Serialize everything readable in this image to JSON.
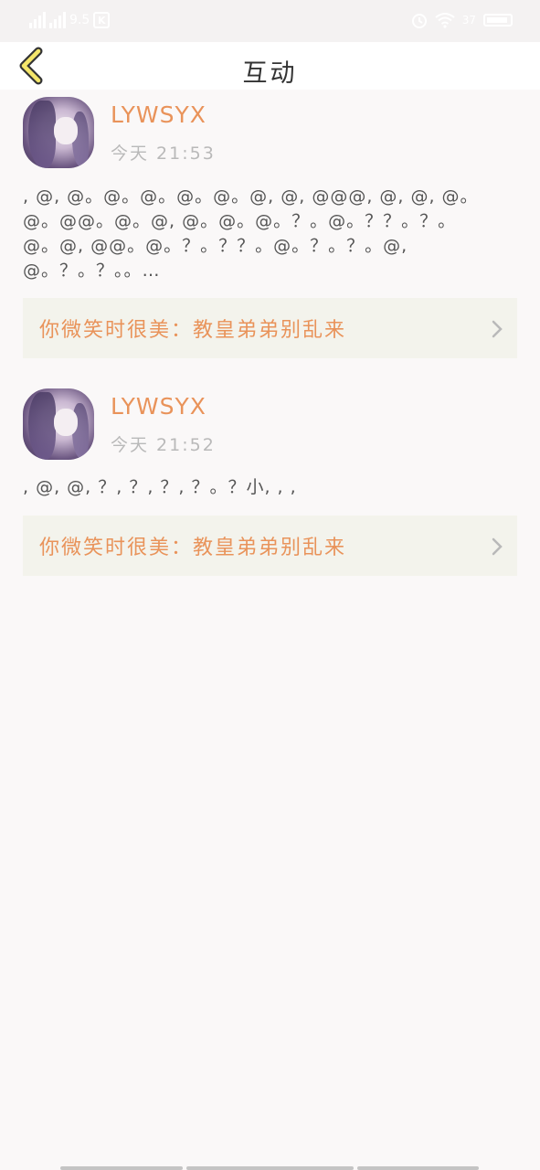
{
  "status_bar": {
    "network_speed": "9.5",
    "carrier_badge": "K",
    "battery_label": "37",
    "icons": [
      "signal-icon",
      "signal-icon",
      "k-app-icon",
      "alarm-icon",
      "wifi-icon",
      "battery-icon"
    ]
  },
  "header": {
    "title": "互动",
    "back_icon": "chevron-left-icon",
    "accent_color": "#f5e66a"
  },
  "interactions": [
    {
      "username": "LYWSYX",
      "time": "今天 21:53",
      "content_lines": [
        ", @, @。@。@。@。@。@, @, @@@, @, @, @。",
        "@。@@。@。@, @。@。@。？。@。？？。？。",
        "@。@, @@。@。？。？？。@。？。？。@,",
        "@。？。？。。…"
      ],
      "link_text": "你微笑时很美：教皇弟弟别乱来"
    },
    {
      "username": "LYWSYX",
      "time": "今天 21:52",
      "content_lines": [
        ", @, @, ？, ？, ？, ？。？小, , ,"
      ],
      "link_text": "你微笑时很美：教皇弟弟别乱来"
    }
  ],
  "colors": {
    "accent": "#e9935a",
    "link_bg": "#f3f3ec",
    "page_bg": "#faf8f8"
  }
}
